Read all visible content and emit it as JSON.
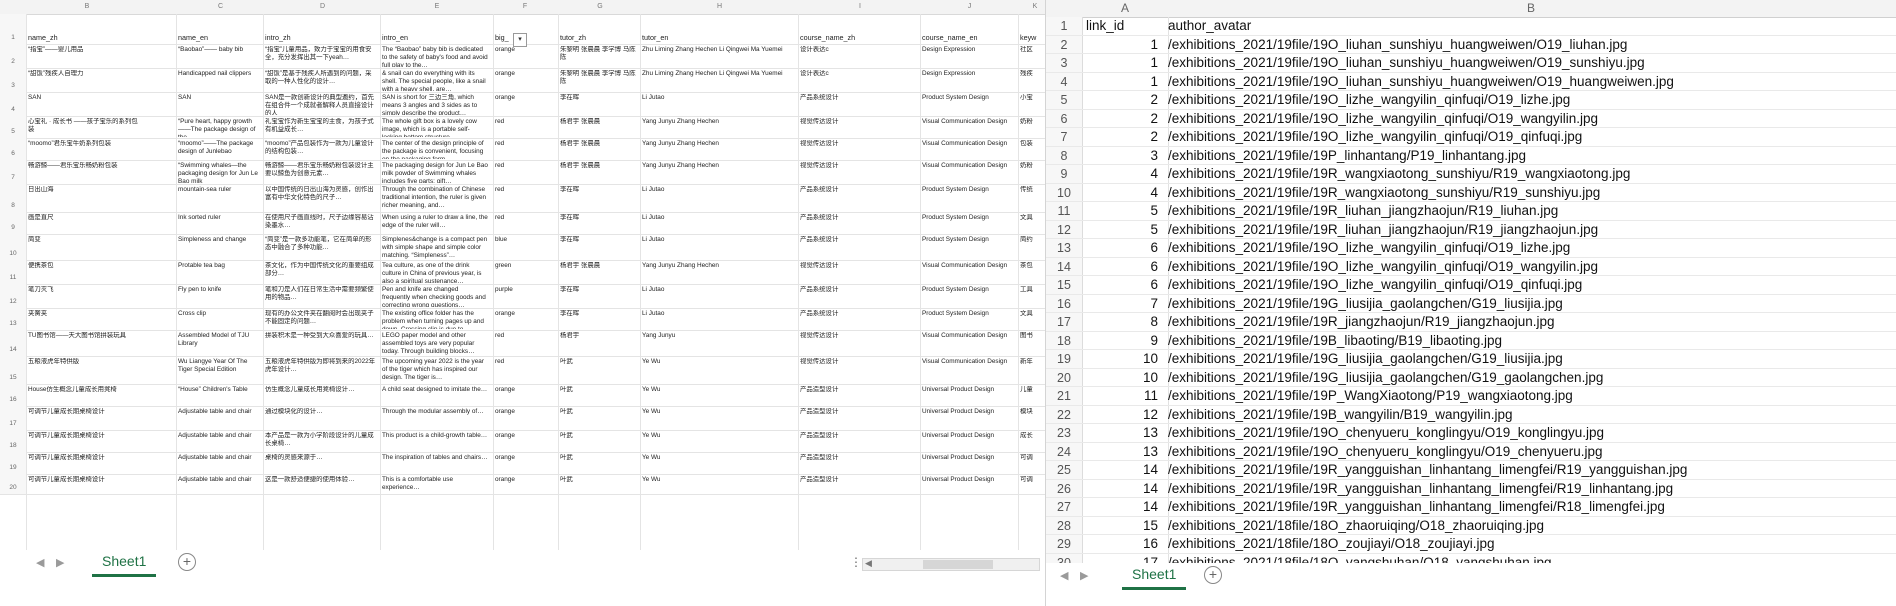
{
  "left_sheet": {
    "columns": [
      "B",
      "C",
      "D",
      "E",
      "F",
      "G",
      "H",
      "I",
      "J",
      "K"
    ],
    "rows": [
      {
        "rn": "1",
        "cells": [
          "name_zh",
          "name_en",
          "intro_zh",
          "intro_en",
          "big_",
          "tutor_zh",
          "tutor_en",
          "course_name_zh",
          "course_name_en",
          "keyw"
        ]
      },
      {
        "rn": "2",
        "cells": [
          "“指宝”——婴儿用品",
          "“Baobao”—— baby bib",
          "“指宝”儿童用品，致力于宝宝的用食安全，充分发挥出其一下yeah…",
          "The “Baobao” baby bib is dedicated to the safety of baby's food and avoid full play to the…",
          "orange",
          "朱黎明 张晨晨 李学博 马陈陈",
          "Zhu Liming Zhang Hechen Li Qingwei Ma Yuemei",
          "设计表达c",
          "Design Expression",
          "社区"
        ]
      },
      {
        "rn": "3",
        "cells": [
          "“甜饭”残疾人自理力",
          "Handicapped nail clippers",
          "“甜饭”是基于残疾人所遇到的问题，采取的一种人性化的设计…",
          "& snail can do everything with its shell. The special people, like a snail with a heavy shell, are…",
          "orange",
          "朱黎明 张晨晨 李学博 马陈陈",
          "Zhu Liming Zhang Hechen Li Qingwei Ma Yuemei",
          "设计表达c",
          "Design Expression",
          "残疾"
        ]
      },
      {
        "rn": "4",
        "cells": [
          "SAN",
          "SAN",
          "SAN是一款创新设计的典型邀约，首先在组合件一个成就者解释人员直接设计的人",
          "SAN is short for 三边三角, which means 3 angles and 3 sides as to simply describe the product…",
          "orange",
          "李在晖",
          "Li Jutao",
          "产品系统设计",
          "Product System Design",
          "小宝"
        ]
      },
      {
        "rn": "5",
        "cells": [
          "心宝礼 · 成长书 ——孩子宝乐的系列包装",
          "“Pure heart, happy growth ——The package design of the…",
          "礼宝宝作为新生宝宝的主食，为孩子式有机益成长…",
          "The whole gift box is a lovely cow image, which is a portable self-locking bottom structure…",
          "red",
          "杨君宇 张晨晨",
          "Yang Junyu Zhang Hechen",
          "视觉传达设计",
          "Visual Communication Design",
          "奶粉"
        ]
      },
      {
        "rn": "6",
        "cells": [
          "“moomo”君乐宝牛奶系列包装",
          "“moomo”——The package design of Junlebao",
          "“moomo”产品包装作为一款为儿童设计的结构包装…",
          "The center of the design principle of the package is convenient, focusing on the packaging form…",
          "red",
          "杨君宇 张晨晨",
          "Yang Junyu Zhang Hechen",
          "视觉传达设计",
          "Visual Communication Design",
          "包装"
        ]
      },
      {
        "rn": "7",
        "cells": [
          "畅游鲸——君乐宝乐畅奶粉包装",
          "“Swimming whales—the packaging design for Jun Le Bao milk",
          "畅游鲸——君乐宝乐畅奶粉包装设计主要以鲸鱼为创意元素…",
          "The packaging design for Jun Le Bao milk powder of Swimming whales includes five parts; gift…",
          "red",
          "杨君宇 张晨晨",
          "Yang Junyu Zhang Hechen",
          "视觉传达设计",
          "Visual Communication Design",
          "奶粉"
        ]
      },
      {
        "rn": "8",
        "cells": [
          "日出山海",
          "mountain-sea ruler",
          "以中国传统的日出山海为灵感，创作出富有中华文化特色的尺子…",
          "Through the combination of Chinese traditional intention, the ruler is given richer meaning, and…",
          "red",
          "李在晖",
          "Li Jutao",
          "产品系统设计",
          "Product System Design",
          "传统"
        ]
      },
      {
        "rn": "9",
        "cells": [
          "画是直尺",
          "Ink sorted ruler",
          "在使用尺子画直线时，尺子边缘容易沾染墨水…",
          "When using a ruler to draw a line, the edge of the ruler will…",
          "red",
          "李在晖",
          "Li Jutao",
          "产品系统设计",
          "Product System Design",
          "文具"
        ]
      },
      {
        "rn": "10",
        "cells": [
          "简变",
          "Simpleness and change",
          "“简变”是一款多功能笔，它在简单的形态中融合了多种功能…",
          "Simplenes&change is a compact pen with simple shape and simple color matching. “Simpleness”…",
          "blue",
          "李在晖",
          "Li Jutao",
          "产品系统设计",
          "Product System Design",
          "简约"
        ]
      },
      {
        "rn": "11",
        "cells": [
          "便携茶包",
          "Protable tea bag",
          "茶文化，作为中国传统文化的重要组成部分…",
          "Tea culture, as one of the drink culture in China of previous year, is also a spiritual sustenance…",
          "green",
          "杨君宇 张晨晨",
          "Yang Junyu Zhang Hechen",
          "视觉传达设计",
          "Visual Communication Design",
          "茶包"
        ]
      },
      {
        "rn": "12",
        "cells": [
          "笔刀灭飞",
          "Fly pen to knife",
          "笔和刀是人们在日常生活中需要频繁使用的物品…",
          "Pen and knife are changed frequently when checking goods and correcting wrong questions…",
          "purple",
          "李在晖",
          "Li Jutao",
          "产品系统设计",
          "Product System Design",
          "工具"
        ]
      },
      {
        "rn": "13",
        "cells": [
          "夹簧夹",
          "Cross clip",
          "现有的办公文件夹在翻阅时会出现夹子不能固定的问题…",
          "The existing office folder has the problem when turning pages up and down. Crossing clip is due to…",
          "orange",
          "李在晖",
          "Li Jutao",
          "产品系统设计",
          "Product System Design",
          "文具"
        ]
      },
      {
        "rn": "14",
        "cells": [
          "TU图书馆——天大图书馆拼装玩具",
          "Assembled Model of TJU Library",
          "拼装积木是一种受到大众喜爱的玩具…",
          "LEGO paper model and other assembled toys are very popular today. Through building blocks…",
          "red",
          "杨君宇",
          "Yang Junyu",
          "视觉传达设计",
          "Visual Communication Design",
          "图书"
        ]
      },
      {
        "rn": "15",
        "cells": [
          "五粮液虎年特供版",
          "Wu Liangye Year Of The Tiger Special Edition",
          "五粮液虎年特供版为即将到来的2022年虎年设计…",
          "The upcoming year 2022 is the year of the tiger which has inspired our design. The tiger is…",
          "red",
          "叶武",
          "Ye Wu",
          "视觉传达设计",
          "Visual Communication Design",
          "新年"
        ]
      },
      {
        "rn": "16",
        "cells": [
          "House仿生概念儿童成长用凳椅",
          "“House” Children's Table",
          "仿生概念儿童成长用凳椅设计…",
          "A child seat designed to imitate the…",
          "orange",
          "叶武",
          "Ye Wu",
          "产品造型设计",
          "Universal Product Design",
          "儿童"
        ]
      },
      {
        "rn": "17",
        "cells": [
          "可调节儿童成长期桌椅设计",
          "Adjustable table and chair",
          "通过模块化的设计…",
          "Through the modular assembly of…",
          "orange",
          "叶武",
          "Ye Wu",
          "产品造型设计",
          "Universal Product Design",
          "模块"
        ]
      },
      {
        "rn": "18",
        "cells": [
          "可调节儿童成长期桌椅设计",
          "Adjustable table and chair",
          "本产品是一款为小学阶段设计的儿童成长桌椅…",
          "This product is a child-growth table…",
          "orange",
          "叶武",
          "Ye Wu",
          "产品造型设计",
          "Universal Product Design",
          "成长"
        ]
      },
      {
        "rn": "19",
        "cells": [
          "可调节儿童成长期桌椅设计",
          "Adjustable table and chair",
          "桌椅的灵感来源于…",
          "The inspiration of tables and chairs…",
          "orange",
          "叶武",
          "Ye Wu",
          "产品造型设计",
          "Universal Product Design",
          "可调"
        ]
      },
      {
        "rn": "20",
        "cells": [
          "可调节儿童成长期桌椅设计",
          "Adjustable table and chair",
          "这是一款舒适便捷的使用体验…",
          "This is a comfortable use experience…",
          "orange",
          "叶武",
          "Ye Wu",
          "产品造型设计",
          "Universal Product Design",
          "可调"
        ]
      }
    ],
    "sheet_tab": "Sheet1",
    "add_sheet_icon": "plus-circle-icon"
  },
  "right_sheet": {
    "columns": [
      "A",
      "B"
    ],
    "header": {
      "rn": "1",
      "a": "link_id",
      "b": "author_avatar"
    },
    "rows": [
      {
        "rn": "2",
        "a": "1",
        "b": "/exhibitions_2021/19file/19O_liuhan_sunshiyu_huangweiwen/O19_liuhan.jpg"
      },
      {
        "rn": "3",
        "a": "1",
        "b": "/exhibitions_2021/19file/19O_liuhan_sunshiyu_huangweiwen/O19_sunshiyu.jpg"
      },
      {
        "rn": "4",
        "a": "1",
        "b": "/exhibitions_2021/19file/19O_liuhan_sunshiyu_huangweiwen/O19_huangweiwen.jpg"
      },
      {
        "rn": "5",
        "a": "2",
        "b": "/exhibitions_2021/19file/19O_lizhe_wangyilin_qinfuqi/O19_lizhe.jpg"
      },
      {
        "rn": "6",
        "a": "2",
        "b": "/exhibitions_2021/19file/19O_lizhe_wangyilin_qinfuqi/O19_wangyilin.jpg"
      },
      {
        "rn": "7",
        "a": "2",
        "b": "/exhibitions_2021/19file/19O_lizhe_wangyilin_qinfuqi/O19_qinfuqi.jpg"
      },
      {
        "rn": "8",
        "a": "3",
        "b": "/exhibitions_2021/19file/19P_linhantang/P19_linhantang.jpg"
      },
      {
        "rn": "9",
        "a": "4",
        "b": "/exhibitions_2021/19file/19R_wangxiaotong_sunshiyu/R19_wangxiaotong.jpg"
      },
      {
        "rn": "10",
        "a": "4",
        "b": "/exhibitions_2021/19file/19R_wangxiaotong_sunshiyu/R19_sunshiyu.jpg"
      },
      {
        "rn": "11",
        "a": "5",
        "b": "/exhibitions_2021/19file/19R_liuhan_jiangzhaojun/R19_liuhan.jpg"
      },
      {
        "rn": "12",
        "a": "5",
        "b": "/exhibitions_2021/19file/19R_liuhan_jiangzhaojun/R19_jiangzhaojun.jpg"
      },
      {
        "rn": "13",
        "a": "6",
        "b": "/exhibitions_2021/19file/19O_lizhe_wangyilin_qinfuqi/O19_lizhe.jpg"
      },
      {
        "rn": "14",
        "a": "6",
        "b": "/exhibitions_2021/19file/19O_lizhe_wangyilin_qinfuqi/O19_wangyilin.jpg"
      },
      {
        "rn": "15",
        "a": "6",
        "b": "/exhibitions_2021/19file/19O_lizhe_wangyilin_qinfuqi/O19_qinfuqi.jpg"
      },
      {
        "rn": "16",
        "a": "7",
        "b": "/exhibitions_2021/19file/19G_liusijia_gaolangchen/G19_liusijia.jpg"
      },
      {
        "rn": "17",
        "a": "8",
        "b": "/exhibitions_2021/19file/19R_jiangzhaojun/R19_jiangzhaojun.jpg"
      },
      {
        "rn": "18",
        "a": "9",
        "b": "/exhibitions_2021/19file/19B_libaoting/B19_libaoting.jpg"
      },
      {
        "rn": "19",
        "a": "10",
        "b": "/exhibitions_2021/19file/19G_liusijia_gaolangchen/G19_liusijia.jpg"
      },
      {
        "rn": "20",
        "a": "10",
        "b": "/exhibitions_2021/19file/19G_liusijia_gaolangchen/G19_gaolangchen.jpg"
      },
      {
        "rn": "21",
        "a": "11",
        "b": "/exhibitions_2021/19file/19P_WangXiaotong/P19_wangxiaotong.jpg"
      },
      {
        "rn": "22",
        "a": "12",
        "b": "/exhibitions_2021/19file/19B_wangyilin/B19_wangyilin.jpg"
      },
      {
        "rn": "23",
        "a": "13",
        "b": "/exhibitions_2021/19file/19O_chenyueru_konglingyu/O19_konglingyu.jpg"
      },
      {
        "rn": "24",
        "a": "13",
        "b": "/exhibitions_2021/19file/19O_chenyueru_konglingyu/O19_chenyueru.jpg"
      },
      {
        "rn": "25",
        "a": "14",
        "b": "/exhibitions_2021/19file/19R_yangguishan_linhantang_limengfei/R19_yangguishan.jpg"
      },
      {
        "rn": "26",
        "a": "14",
        "b": "/exhibitions_2021/19file/19R_yangguishan_linhantang_limengfei/R19_linhantang.jpg"
      },
      {
        "rn": "27",
        "a": "14",
        "b": "/exhibitions_2021/19file/19R_yangguishan_linhantang_limengfei/R18_limengfei.jpg"
      },
      {
        "rn": "28",
        "a": "15",
        "b": "/exhibitions_2021/18file/18O_zhaoruiqing/O18_zhaoruiqing.jpg"
      },
      {
        "rn": "29",
        "a": "16",
        "b": "/exhibitions_2021/18file/18O_zoujiayi/O18_zoujiayi.jpg"
      },
      {
        "rn": "30",
        "a": "17",
        "b": "/exhibitions_2021/18file/18O_yangshuhan/O18_yangshuhan.jpg"
      }
    ],
    "sheet_tab": "Sheet1",
    "add_sheet_icon": "plus-circle-icon"
  },
  "colors": {
    "tab_accent": "#1f7245",
    "grid": "#e4e4e4",
    "header_bg": "#f3f3f3"
  }
}
